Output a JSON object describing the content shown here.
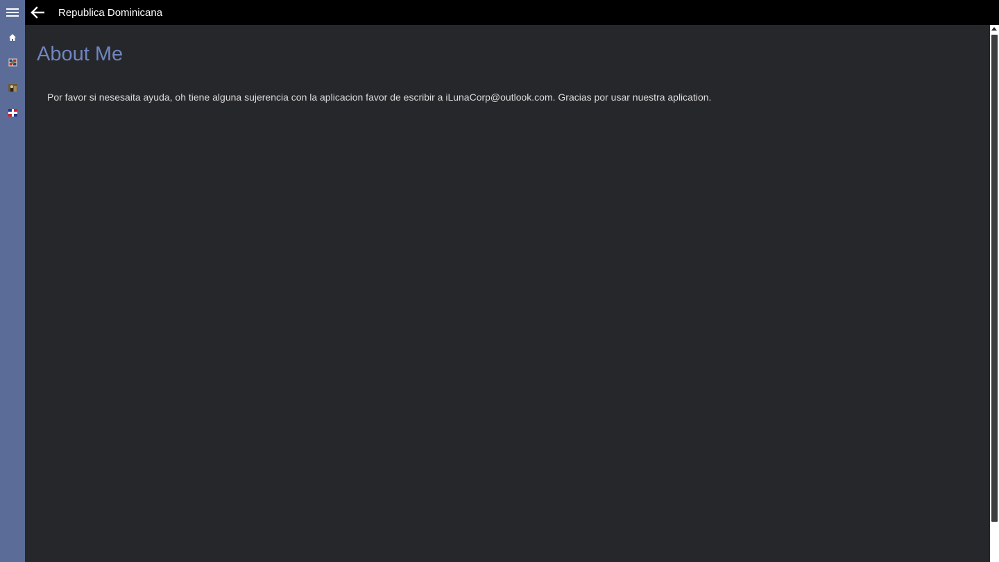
{
  "window": {
    "title": "Republica Dominicana"
  },
  "icons": {
    "menu": "hamburger-menu-icon",
    "back": "back-arrow-icon",
    "home": "home-icon",
    "coat_of_arms": "coat-of-arms-icon",
    "portrait": "portrait-icon",
    "flag": "dominican-flag-icon"
  },
  "colors": {
    "sidebar": "#5b6c98",
    "titlebar": "#000000",
    "content_bg": "#26272b",
    "page_title": "#6f86c0",
    "body_text": "#dcdcdc"
  },
  "main": {
    "page_title": "About Me",
    "body_text": "Por favor si nesesaita ayuda, oh tiene alguna sujerencia con la aplicacion favor de escribir a iLunaCorp@outlook.com. Gracias por usar nuestra aplication."
  }
}
